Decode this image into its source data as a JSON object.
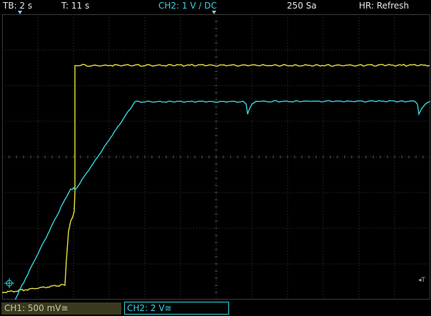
{
  "header": {
    "timebase": "TB: 2 s",
    "trigger_time": "T: 11 s",
    "trigger_channel": "CH2: 1 V ∕ DC",
    "sample_rate": "250 Sa",
    "mode": "HR: Refresh"
  },
  "footer": {
    "ch1": "CH1: 500 mV≅",
    "ch2": "CH2: 2 V≅"
  },
  "colors": {
    "ch1": "#e8e23a",
    "ch2": "#33d6e0",
    "grid": "#3a3a3a",
    "background": "#000000"
  },
  "icons": {
    "timebase_marker": "down-triangle-icon",
    "trigger_marker": "down-triangle-icon",
    "ground_marker": "crosshair-icon",
    "trigger_level_marker": "T-arrow-icon"
  },
  "trigger_level_label": "◂T"
}
